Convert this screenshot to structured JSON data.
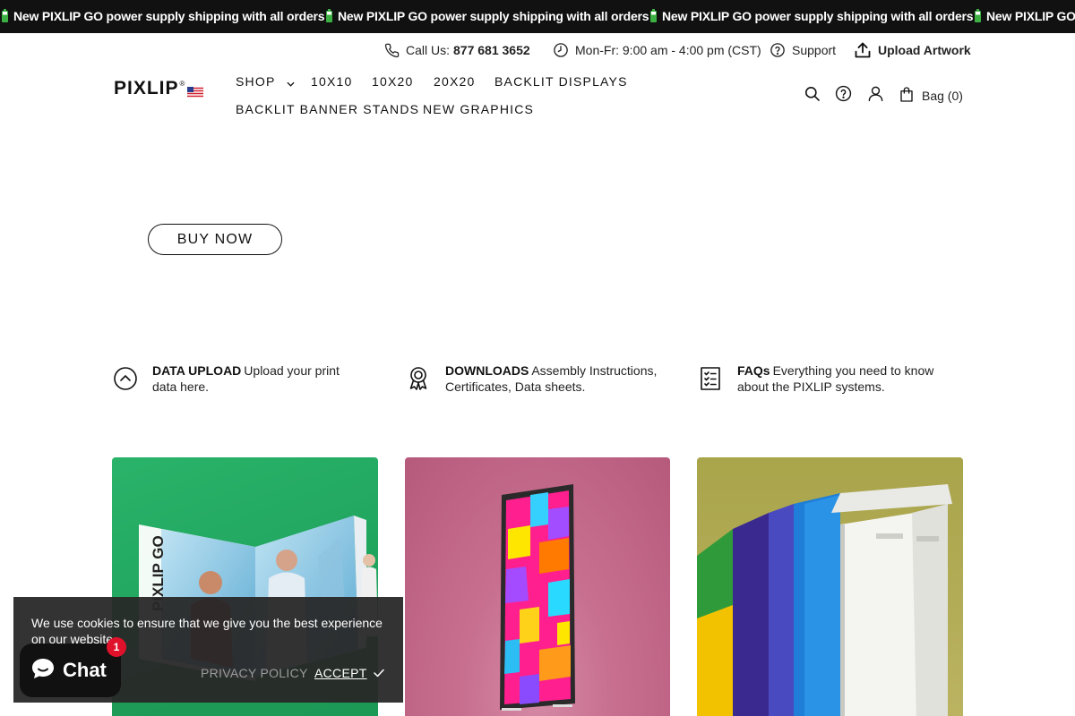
{
  "announcement": {
    "messages": [
      "New PIXLIP GO power supply shipping with all orders",
      "New PIXLIP GO power supply shipping with all orders",
      "New PIXLIP GO power supply shipping with all orders",
      "New PIXLIP GO power supply shipping with all orders"
    ],
    "icon": "battery-icon"
  },
  "utility": {
    "call_label": "Call Us:",
    "call_number": "877 681 3652",
    "hours": "Mon-Fr: 9:00 am - 4:00 pm (CST)",
    "support": "Support",
    "upload": "Upload Artwork"
  },
  "logo": {
    "text": "PIXLIP",
    "reg": "®"
  },
  "nav": {
    "shop": "SHOP",
    "items": [
      "10X10",
      "10X20",
      "20X20",
      "BACKLIT DISPLAYS",
      "BACKLIT BANNER STANDS",
      "NEW GRAPHICS"
    ]
  },
  "header": {
    "bag_label": "Bag (0)"
  },
  "hero": {
    "buy_now": "BUY NOW"
  },
  "features": [
    {
      "title": "DATA UPLOAD",
      "text": "Upload your print data here.",
      "icon": "upload-circle-icon"
    },
    {
      "title": "DOWNLOADS",
      "text": "Assembly Instructions, Certificates, Data sheets.",
      "icon": "award-ribbon-icon"
    },
    {
      "title": "FAQs",
      "text": "Everything you need to know about the PIXLIP systems.",
      "icon": "checklist-icon"
    }
  ],
  "cards": [
    {
      "image": "pixlip-go-booth-image",
      "brand_print": "PIXLIP GO"
    },
    {
      "image": "backlit-tower-image"
    },
    {
      "image": "backlit-cube-image"
    }
  ],
  "cookie": {
    "text": "We use cookies to ensure that we give you the best experience on our website.",
    "privacy": "PRIVACY POLICY",
    "accept": "ACCEPT"
  },
  "chat": {
    "label": "Chat",
    "badge": "1"
  },
  "colors": {
    "announce_bg": "#111111",
    "card1": "#22a862",
    "card2": "#c46e8e",
    "card3": "#b0ab55",
    "badge": "#e0112b"
  }
}
